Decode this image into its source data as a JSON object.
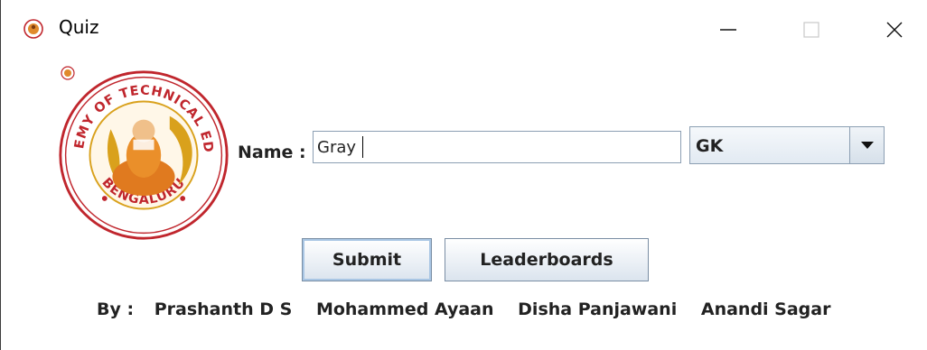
{
  "window": {
    "title": "Quiz"
  },
  "form": {
    "name_label": "Name :",
    "name_value": "Gray",
    "category_selected": "GK"
  },
  "buttons": {
    "submit_label": "Submit",
    "leaderboards_label": "Leaderboards"
  },
  "credits": {
    "by_label": "By :",
    "authors": [
      "Prashanth D S",
      "Mohammed Ayaan",
      "Disha Panjawani",
      "Anandi Sagar"
    ]
  },
  "logo": {
    "top_text": "JSS ACADEMY OF TECHNICAL EDUCATION",
    "bottom_text": "BENGALURU"
  },
  "colors": {
    "logo_red": "#c0262d",
    "logo_gold": "#d9a11c",
    "button_border": "#7a8ea4",
    "focus_ring": "#a9c6e4"
  },
  "icons": {
    "app_icon": "logo-icon",
    "minimize": "minimize-icon",
    "maximize": "maximize-icon",
    "close": "close-icon",
    "dropdown": "chevron-down-icon"
  }
}
